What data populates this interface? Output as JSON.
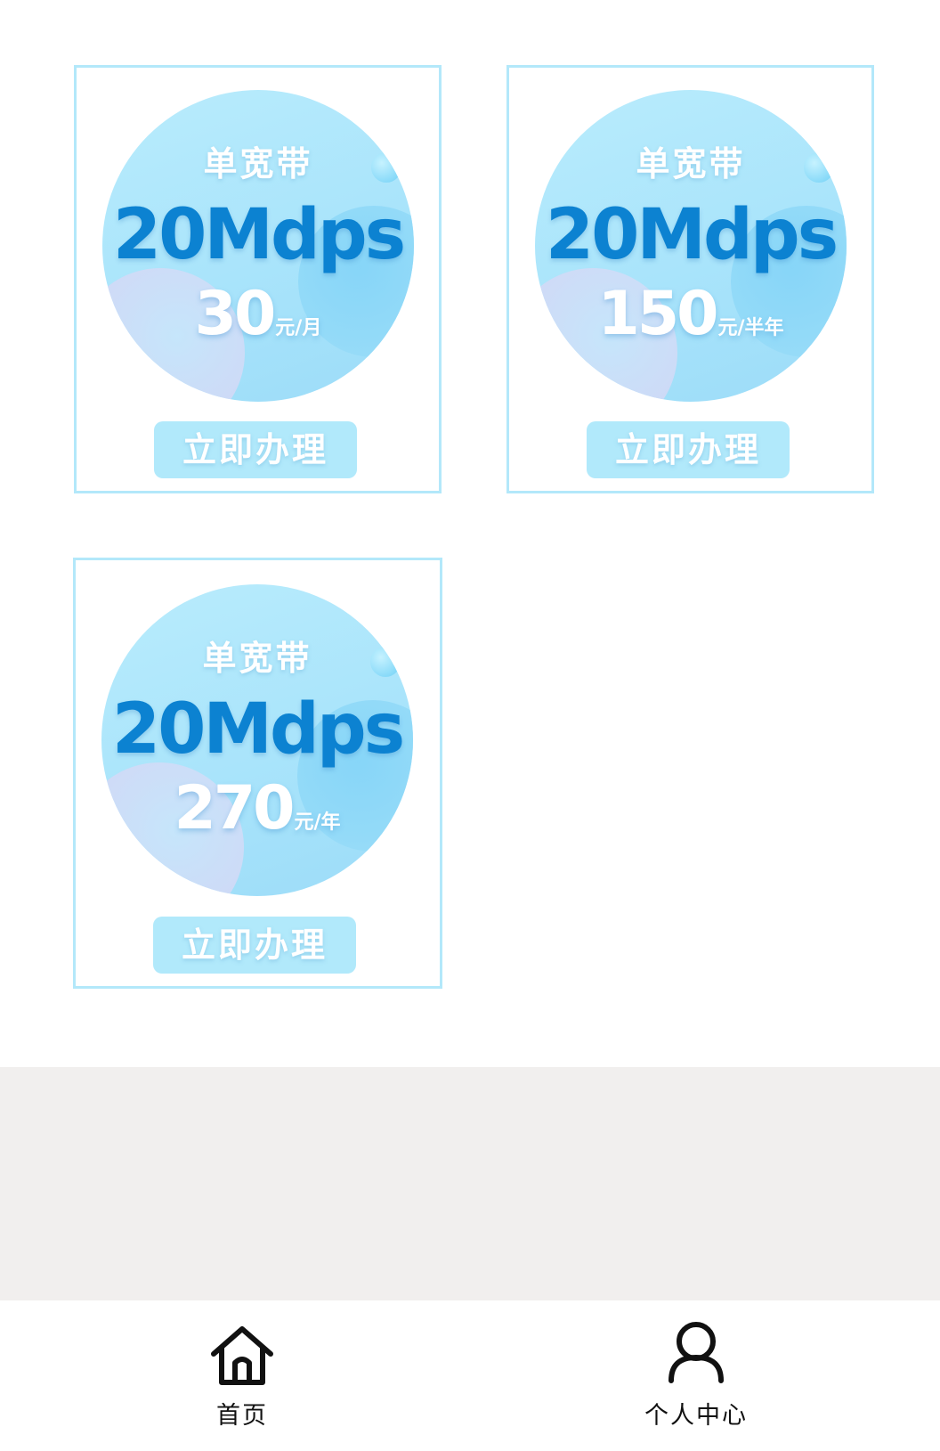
{
  "plans": [
    {
      "label": "单宽带",
      "speed": "20Mdps",
      "price": "30",
      "unit": "元/月",
      "button": "立即办理"
    },
    {
      "label": "单宽带",
      "speed": "20Mdps",
      "price": "150",
      "unit": "元/半年",
      "button": "立即办理"
    },
    {
      "label": "单宽带",
      "speed": "20Mdps",
      "price": "270",
      "unit": "元/年",
      "button": "立即办理"
    }
  ],
  "tabbar": {
    "home": {
      "label": "首页",
      "icon": "home-icon"
    },
    "profile": {
      "label": "个人中心",
      "icon": "user-icon"
    }
  },
  "colors": {
    "card_border": "#b3e8fa",
    "circle": "#aee6fb",
    "speed_text": "#0c82d1",
    "button_bg": "#b1e9fb",
    "footer_bg": "#f1efee"
  }
}
